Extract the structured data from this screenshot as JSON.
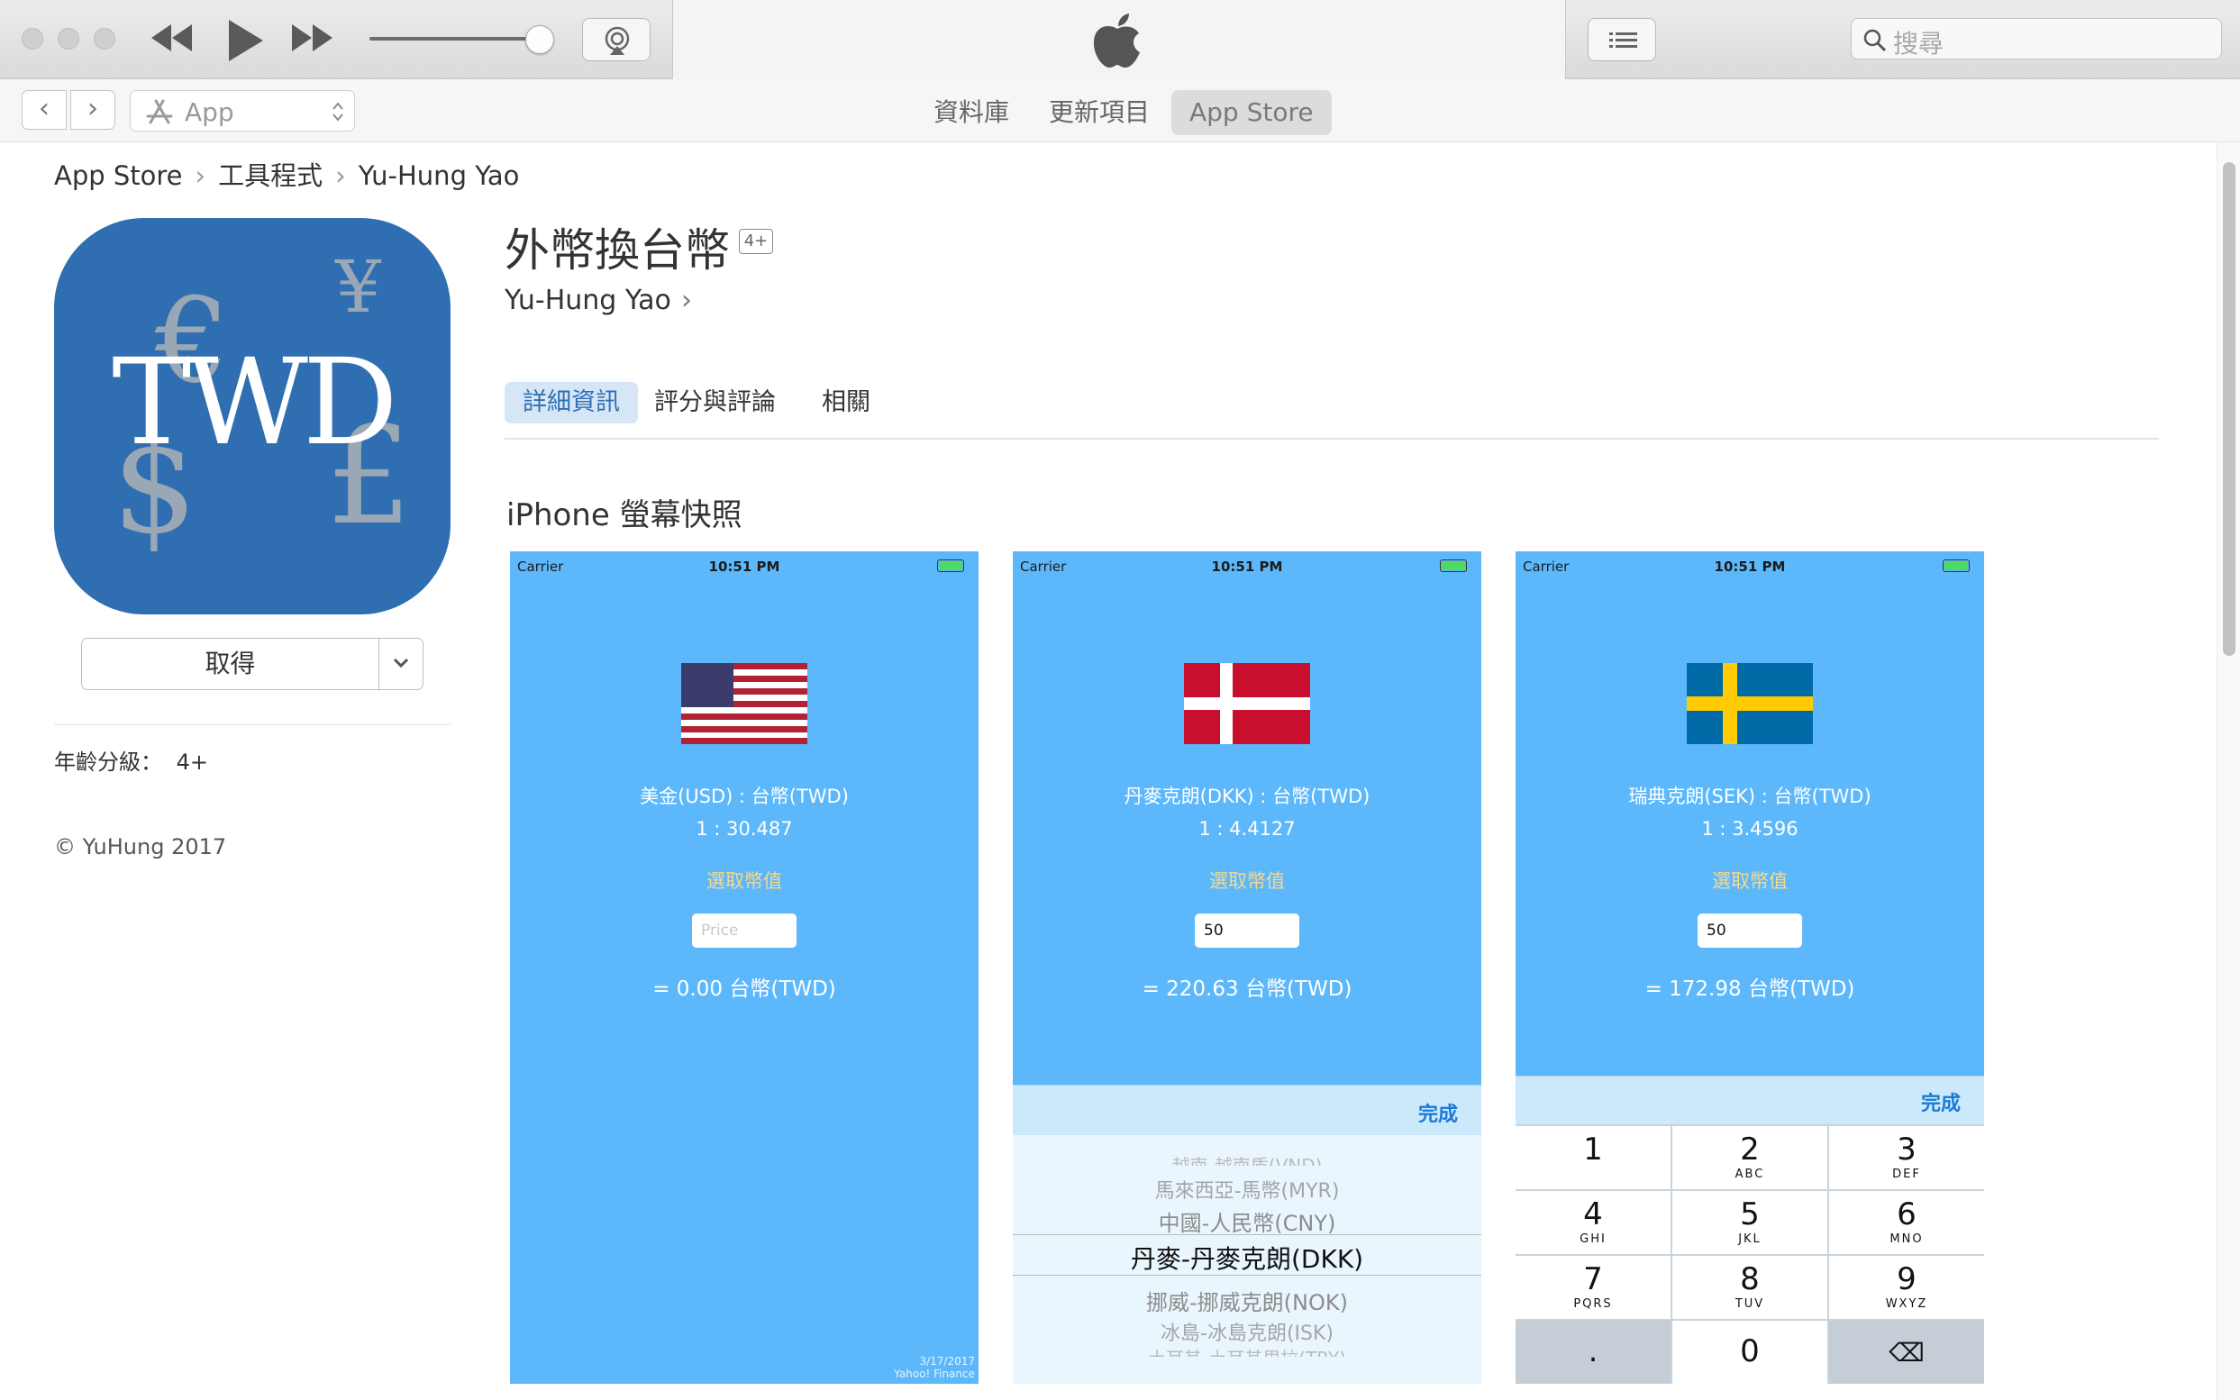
{
  "toolbar": {
    "search_placeholder": "搜尋"
  },
  "navbar": {
    "media_label": "App",
    "tabs": [
      "資料庫",
      "更新項目",
      "App Store"
    ],
    "active_tab": "App Store"
  },
  "breadcrumb": [
    "App Store",
    "工具程式",
    "Yu-Hung Yao"
  ],
  "app": {
    "icon_text": "TWD",
    "title": "外幣換台幣",
    "age_badge": "4+",
    "developer": "Yu-Hung Yao",
    "get_label": "取得",
    "age_label": "年齡分級：",
    "age_value": "4+",
    "copyright": "© YuHung 2017"
  },
  "detail_tabs": [
    "詳細資訊",
    "評分與評論",
    "相關"
  ],
  "section_title": "iPhone 螢幕快照",
  "screenshots": [
    {
      "carrier": "Carrier",
      "time": "10:51 PM",
      "rate_title": "美金(USD) : 台幣(TWD)",
      "rate_value": "1 : 30.487",
      "pick_label": "選取幣值",
      "input_placeholder": "Price",
      "result": "= 0.00 台幣(TWD)",
      "credit_date": "3/17/2017",
      "credit_source": "Yahoo! Finance"
    },
    {
      "carrier": "Carrier",
      "time": "10:51 PM",
      "rate_title": "丹麥克朗(DKK) : 台幣(TWD)",
      "rate_value": "1 : 4.4127",
      "pick_label": "選取幣值",
      "input_value": "50",
      "result": "= 220.63 台幣(TWD)",
      "done_label": "完成",
      "picker_items": [
        "越南-越南盾(VND)",
        "馬來西亞-馬幣(MYR)",
        "中國-人民幣(CNY)",
        "丹麥-丹麥克朗(DKK)",
        "挪威-挪威克朗(NOK)",
        "冰島-冰島克朗(ISK)",
        "土耳其-土耳其里拉(TRY)"
      ]
    },
    {
      "carrier": "Carrier",
      "time": "10:51 PM",
      "rate_title": "瑞典克朗(SEK) : 台幣(TWD)",
      "rate_value": "1 : 3.4596",
      "pick_label": "選取幣值",
      "input_value": "50",
      "result": "= 172.98 台幣(TWD)",
      "done_label": "完成",
      "keys": [
        {
          "digit": "1",
          "letters": ""
        },
        {
          "digit": "2",
          "letters": "ABC"
        },
        {
          "digit": "3",
          "letters": "DEF"
        },
        {
          "digit": "4",
          "letters": "GHI"
        },
        {
          "digit": "5",
          "letters": "JKL"
        },
        {
          "digit": "6",
          "letters": "MNO"
        },
        {
          "digit": "7",
          "letters": "PQRS"
        },
        {
          "digit": "8",
          "letters": "TUV"
        },
        {
          "digit": "9",
          "letters": "WXYZ"
        },
        {
          "digit": ".",
          "letters": ""
        },
        {
          "digit": "0",
          "letters": ""
        },
        {
          "digit": "⌫",
          "letters": ""
        }
      ]
    }
  ]
}
